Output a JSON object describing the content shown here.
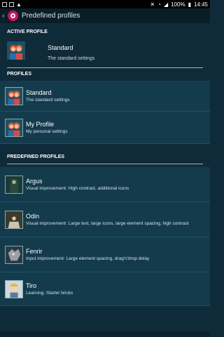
{
  "status": {
    "battery": "100%",
    "time": "14:45"
  },
  "actionbar": {
    "title": "Predefined profiles"
  },
  "active_section": {
    "label": "ACTIVE PROFILE",
    "name": "Standard",
    "description": "The standard settings"
  },
  "profiles_section": {
    "label": "PROFILES",
    "items": [
      {
        "name": "Standard",
        "description": "The standard settings"
      },
      {
        "name": "My Profile",
        "description": "My personal settings"
      }
    ]
  },
  "predefined_section": {
    "label": "PREDEFINED PROFILES",
    "items": [
      {
        "name": "Argus",
        "description": "Visual improvement: High contrast, additional icons"
      },
      {
        "name": "Odin",
        "description": "Visual improvement: Large text, large icons, large element spacing, high contrast"
      },
      {
        "name": "Fenrir",
        "description": "Input improvement: Large element spacing, drag'n'drop delay"
      },
      {
        "name": "Tiro",
        "description": "Learning: Starter bricks"
      }
    ]
  }
}
